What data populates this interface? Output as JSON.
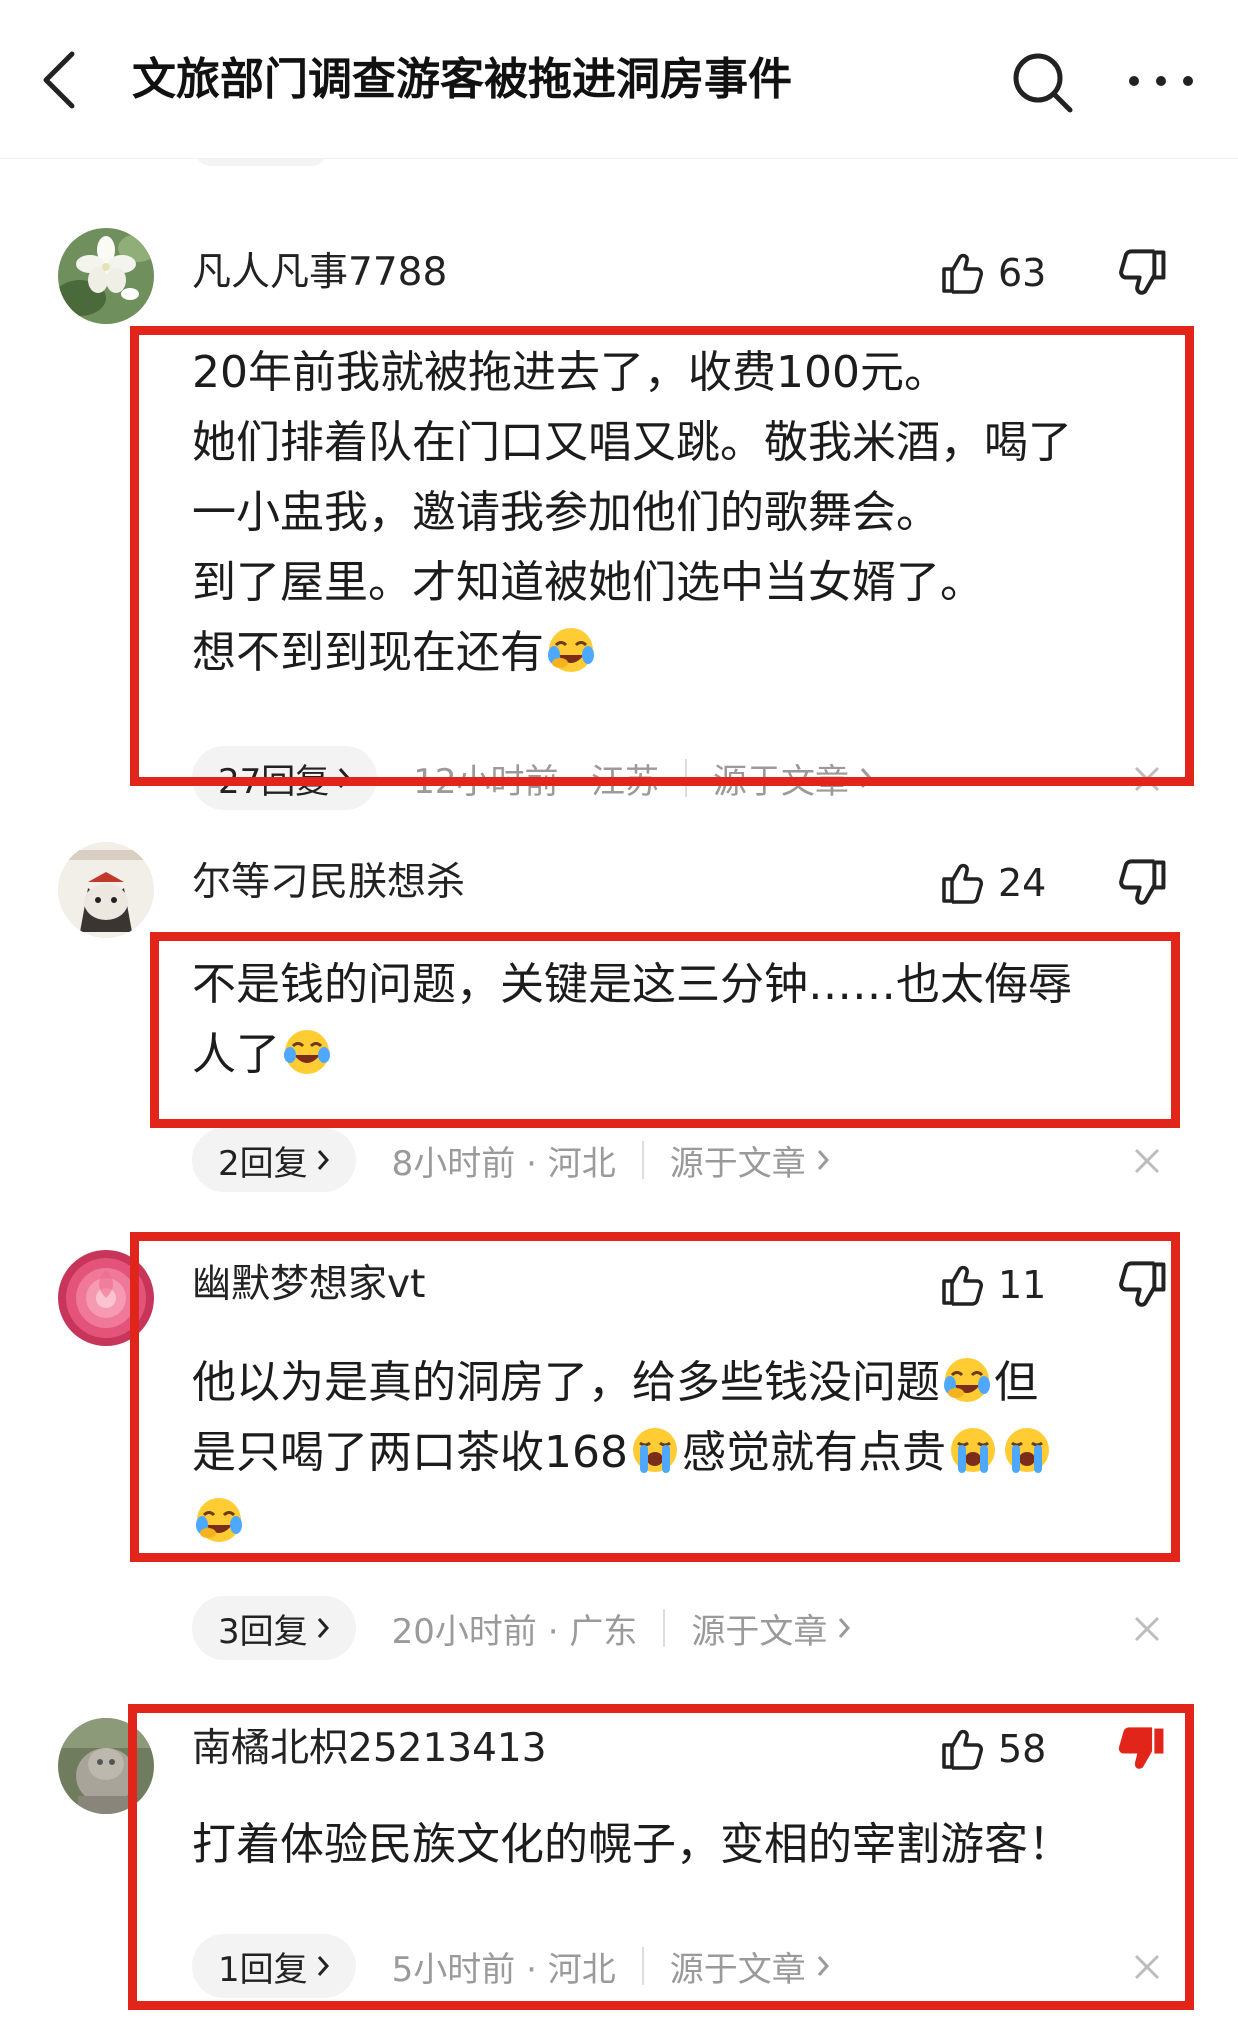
{
  "header": {
    "title": "文旅部门调查游客被拖进洞房事件",
    "back_icon": "chevron-left-icon",
    "search_icon": "search-icon",
    "more_icon": "more-dots-icon"
  },
  "colors": {
    "highlight": "#e1251b",
    "meta_text": "#9a9a9a",
    "dislike_active": "#e1251b"
  },
  "comments": [
    {
      "username": "凡人凡事7788",
      "likes": "63",
      "lines": [
        "20年前我就被拖进去了，收费100元。",
        "她们排着队在门口又唱又跳。敬我米酒，喝了",
        "一小盅我，邀请我参加他们的歌舞会。",
        "到了屋里。才知道被她们选中当女婿了。",
        "想不到到现在还有"
      ],
      "reply_label": "27回复",
      "time_location": "12小时前 · 江苏",
      "source_label": "源于文章"
    },
    {
      "username": "尔等刁民朕想杀",
      "likes": "24",
      "lines": [
        "不是钱的问题，关键是这三分钟……也太侮辱",
        "人了"
      ],
      "reply_label": "2回复",
      "time_location": "8小时前 · 河北",
      "source_label": "源于文章"
    },
    {
      "username": "幽默梦想家vt",
      "likes": "11",
      "lines_parts": [
        "他以为是真的洞房了，给多些钱没问题",
        "但",
        "是只喝了两口茶收168",
        "感觉就有点贵"
      ],
      "reply_label": "3回复",
      "time_location": "20小时前 · 广东",
      "source_label": "源于文章"
    },
    {
      "username": "南橘北枳25213413",
      "likes": "58",
      "lines": [
        "打着体验民族文化的幌子，变相的宰割游客！"
      ],
      "reply_label": "1回复",
      "time_location": "5小时前 · 河北",
      "source_label": "源于文章"
    }
  ]
}
